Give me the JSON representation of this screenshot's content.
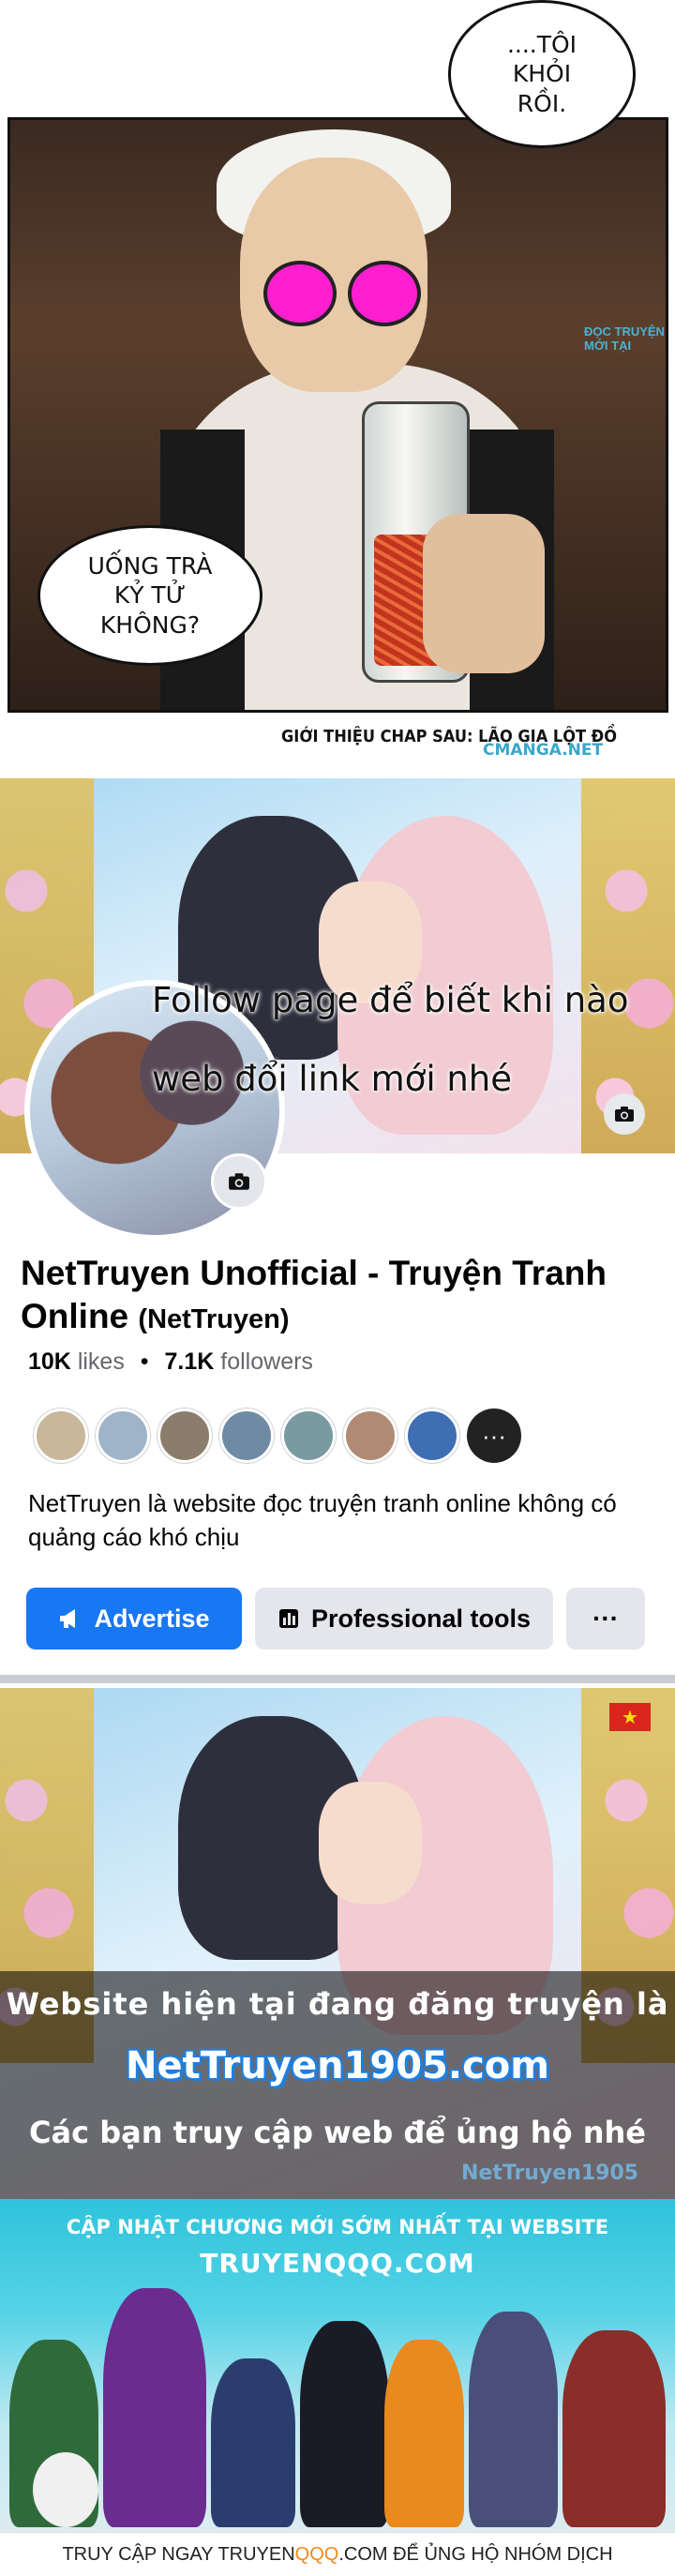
{
  "manga_panel": {
    "bubble_top": "....TÔI\nKHỎI\nRỒI.",
    "bubble_left": "UỐNG TRÀ\nKỶ TỬ\nKHÔNG?",
    "next_chapter": "GIỚI THIỆU CHAP SAU: LÃO GIA LỘT ĐỒ",
    "watermark": "CMANGA.NET",
    "watermark_top": "ĐỌC TRUYỆN MỚI TẠI"
  },
  "facebook_page": {
    "cover_caption": "Follow page để biết khi nào web đổi link mới nhé",
    "camera_icon": "camera-icon",
    "name": "NetTruyen Unofficial - Truyện Tranh Online",
    "alias": "(NetTruyen)",
    "likes_count": "10K",
    "likes_label": "likes",
    "followers_count": "7.1K",
    "followers_label": "followers",
    "friend_avatars": [
      "#c8b79a",
      "#9fb3c9",
      "#8b7d6b",
      "#6f8aa3",
      "#7a9aa1",
      "#b08a74",
      "#3f6fb2"
    ],
    "more_icon": "···",
    "description": "NetTruyen là website đọc truyện tranh online không có quảng cáo khó chịu",
    "advertise_label": "Advertise",
    "advertise_icon": "megaphone-icon",
    "professional_tools_label": "Professional tools",
    "professional_tools_icon": "chart-icon",
    "more_button_label": "···",
    "brand_blue": "#1877f2"
  },
  "site_banner": {
    "line1": "Website hiện tại đang đăng truyện là",
    "line2": "NetTruyen1905.com",
    "line3": "Các bạn truy cập web để ủng hộ nhé",
    "watermark": "NetTruyen1905",
    "flag_icon": "vietnam-flag-icon"
  },
  "qqq_banner": {
    "heading1": "CẬP NHẬT CHƯƠNG MỚI SỚM NHẤT TẠI WEBSITE",
    "heading2": "TRUYENQQQ.COM",
    "footer_pre": "TRUY CẬP NGAY TRUYEN",
    "footer_highlight": "QQQ",
    "footer_post": ".COM ĐỂ ỦNG HỘ NHÓM DỊCH",
    "highlight_color": "#f08a1c"
  }
}
